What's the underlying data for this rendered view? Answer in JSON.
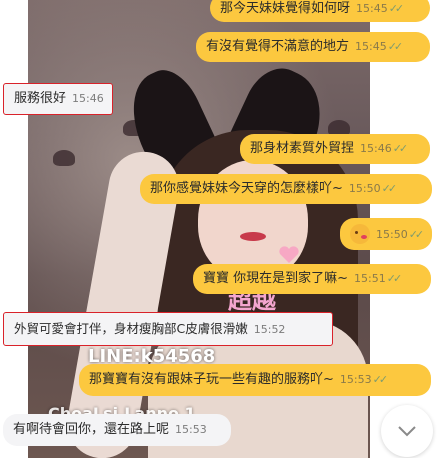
{
  "background": {
    "overlay_line": "LINE:k54568",
    "overlay_line2": "ChoaLsi.Lanno 1",
    "overlay_pink": "超越"
  },
  "messages": [
    {
      "dir": "out",
      "text": "那今天妹妹覺得如何呀",
      "time": "15:45"
    },
    {
      "dir": "out",
      "text": "有沒有覺得不滿意的地方",
      "time": "15:45"
    },
    {
      "dir": "in",
      "text": "服務很好",
      "time": "15:46",
      "highlighted": true
    },
    {
      "dir": "out",
      "text": "那身材素質外貿捏",
      "time": "15:46"
    },
    {
      "dir": "out",
      "text": "那你感覺妹妹今天穿的怎麼樣吖~",
      "time": "15:50"
    },
    {
      "dir": "out",
      "text": "",
      "emoji": "kiss-face",
      "time": "15:50"
    },
    {
      "dir": "out",
      "text": "寶寶 你現在是到家了嘛~",
      "time": "15:51"
    },
    {
      "dir": "in",
      "text": "外貿可愛會打伴，身材瘦胸部C皮膚很滑嫩",
      "time": "15:52",
      "highlighted": true
    },
    {
      "dir": "out",
      "text": "那寶寶有沒有跟妹子玩一些有趣的服務吖~",
      "time": "15:53"
    },
    {
      "dir": "in",
      "text": "有啊待會回你，還在路上呢",
      "time": "15:53",
      "highlighted": false
    }
  ],
  "colors": {
    "outgoing_bubble": "#fcc83f",
    "incoming_bubble": "#f4f4f6",
    "highlight_border": "#d9222a",
    "read_check": "#7f9c6d"
  },
  "icons": {
    "read_receipt": "double-check-icon",
    "scroll_down": "chevron-down-icon"
  }
}
